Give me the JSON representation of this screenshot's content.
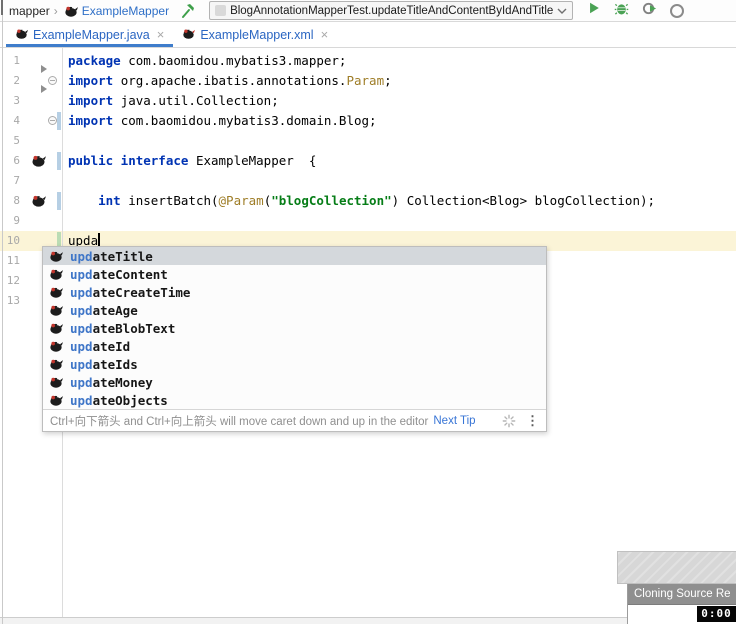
{
  "topbar": {
    "breadcrumb": [
      {
        "label": "mapper"
      },
      {
        "label": "ExampleMapper"
      }
    ],
    "run_config": "BlogAnnotationMapperTest.updateTitleAndContentByIdAndTitle"
  },
  "tabs": [
    {
      "label": "ExampleMapper.java",
      "active": true
    },
    {
      "label": "ExampleMapper.xml",
      "active": false
    }
  ],
  "icons": {
    "close": "×",
    "breadcrumb_separator": "›",
    "kebab": "⋮"
  },
  "editor": {
    "lines": [
      {
        "n": 1,
        "segs": [
          {
            "t": "package ",
            "c": "kw"
          },
          {
            "t": "com.baomidou.mybatis3.mapper;",
            "c": "pl"
          }
        ]
      },
      {
        "n": 2,
        "fold": true,
        "segs": [
          {
            "t": "import ",
            "c": "kw"
          },
          {
            "t": "org.apache.ibatis.annotations.",
            "c": "pl"
          },
          {
            "t": "Param",
            "c": "ann"
          },
          {
            "t": ";",
            "c": "pl"
          }
        ]
      },
      {
        "n": 3,
        "segs": [
          {
            "t": "import ",
            "c": "kw"
          },
          {
            "t": "java.util.Collection;",
            "c": "pl"
          }
        ]
      },
      {
        "n": 4,
        "fold": true,
        "vcs": "mod",
        "segs": [
          {
            "t": "import ",
            "c": "kw"
          },
          {
            "t": "com.baomidou.mybatis3.domain.Blog;",
            "c": "pl"
          }
        ]
      },
      {
        "n": 5,
        "segs": []
      },
      {
        "n": 6,
        "icon": "mybatis-bird",
        "vcs": "mod",
        "segs": [
          {
            "t": "public interface ",
            "c": "kw"
          },
          {
            "t": "ExampleMapper  {",
            "c": "pl"
          }
        ]
      },
      {
        "n": 7,
        "segs": []
      },
      {
        "n": 8,
        "icon": "mybatis-bird",
        "vcs": "mod",
        "segs": [
          {
            "t": "    ",
            "c": "pl"
          },
          {
            "t": "int ",
            "c": "kw"
          },
          {
            "t": "insertBatch(",
            "c": "pl"
          },
          {
            "t": "@Param",
            "c": "ann"
          },
          {
            "t": "(",
            "c": "pl"
          },
          {
            "t": "\"blogCollection\"",
            "c": "str"
          },
          {
            "t": ") Collection<Blog> blogCollection);",
            "c": "pl"
          }
        ]
      },
      {
        "n": 9,
        "segs": []
      },
      {
        "n": 10,
        "vcs": "add",
        "caret_row": true,
        "caret": true,
        "segs": [
          {
            "t": "upda",
            "c": "pl"
          }
        ]
      },
      {
        "n": 11,
        "segs": []
      },
      {
        "n": 12,
        "segs": []
      },
      {
        "n": 13,
        "segs": []
      }
    ]
  },
  "completion": {
    "prefix": "upd",
    "selected_index": 0,
    "items": [
      "updateTitle",
      "updateContent",
      "updateCreateTime",
      "updateAge",
      "updateBlobText",
      "updateId",
      "updateIds",
      "updateMoney",
      "updateObjects"
    ],
    "footer_tip": "Ctrl+向下箭头 and Ctrl+向上箭头 will move caret down and up in the editor",
    "footer_link": "Next Tip"
  },
  "clone_dialog": {
    "title": "Cloning Source Re",
    "timer": "0:00"
  },
  "colors": {
    "accent_blue": "#3f7dcb",
    "tab_modified_blue": "#2b66c2",
    "keyword": "#0033b3",
    "annotation": "#9e7d27",
    "string": "#067d17",
    "run_green": "#4aa254",
    "caret_row": "#fbf4d7",
    "vcs_modified": "#b6cfe4",
    "vcs_added": "#bbdcb4",
    "selection_gray": "#d4d8dc"
  }
}
